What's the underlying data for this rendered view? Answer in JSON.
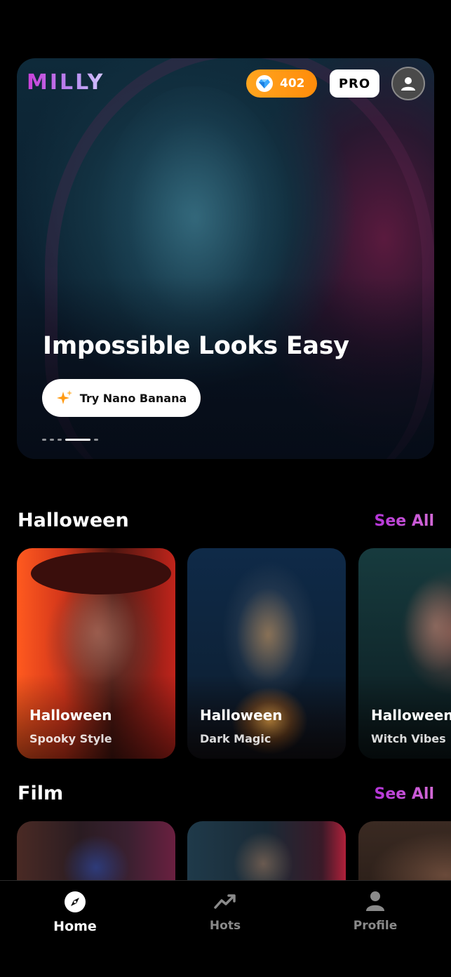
{
  "app": {
    "logo": "MILLY"
  },
  "header": {
    "gems_count": "402",
    "pro_label": "PRO",
    "gem_icon": "diamond-icon",
    "profile_icon": "user-icon"
  },
  "hero": {
    "title": "Impossible Looks Easy",
    "cta_label": "Try Nano Banana",
    "cta_icon": "sparkle-icon",
    "carousel_total": 5,
    "carousel_active": 4
  },
  "sections": [
    {
      "title": "Halloween",
      "see_all": "See All",
      "cards": [
        {
          "title": "Halloween",
          "subtitle": "Spooky Style"
        },
        {
          "title": "Halloween",
          "subtitle": "Dark Magic"
        },
        {
          "title": "Halloween",
          "subtitle": "Witch Vibes"
        }
      ]
    },
    {
      "title": "Film",
      "see_all": "See All",
      "cards": []
    }
  ],
  "tabs": [
    {
      "label": "Home",
      "icon": "compass-icon",
      "active": true
    },
    {
      "label": "Hots",
      "icon": "trending-icon",
      "active": false
    },
    {
      "label": "Profile",
      "icon": "person-icon",
      "active": false
    }
  ],
  "colors": {
    "accent_purple": "#b535d8",
    "gem_orange": "#ff9a12",
    "background": "#000000"
  }
}
